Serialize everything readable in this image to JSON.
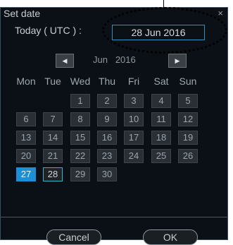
{
  "dialog": {
    "title": "Set date",
    "close_glyph": "×",
    "today_label": "Today ( UTC ) :",
    "today_value": "28 Jun 2016"
  },
  "navigation": {
    "prev_glyph": "◀",
    "next_glyph": "▶",
    "month": "Jun",
    "year": "2016"
  },
  "weekdays": [
    "Mon",
    "Tue",
    "Wed",
    "Thu",
    "Fri",
    "Sat",
    "Sun"
  ],
  "weeks": [
    [
      "",
      "",
      "1",
      "2",
      "3",
      "4",
      "5"
    ],
    [
      "6",
      "7",
      "8",
      "9",
      "10",
      "11",
      "12"
    ],
    [
      "13",
      "14",
      "15",
      "16",
      "17",
      "18",
      "19"
    ],
    [
      "20",
      "21",
      "22",
      "23",
      "24",
      "25",
      "26"
    ],
    [
      "27",
      "28",
      "29",
      "30",
      "",
      "",
      ""
    ]
  ],
  "selected_day": "27",
  "today_day": "28",
  "buttons": {
    "cancel": "Cancel",
    "ok": "OK"
  },
  "colors": {
    "selected": "#1d8fd6",
    "today_border": "#2fb7c9",
    "field_border": "#2f8fc2"
  }
}
